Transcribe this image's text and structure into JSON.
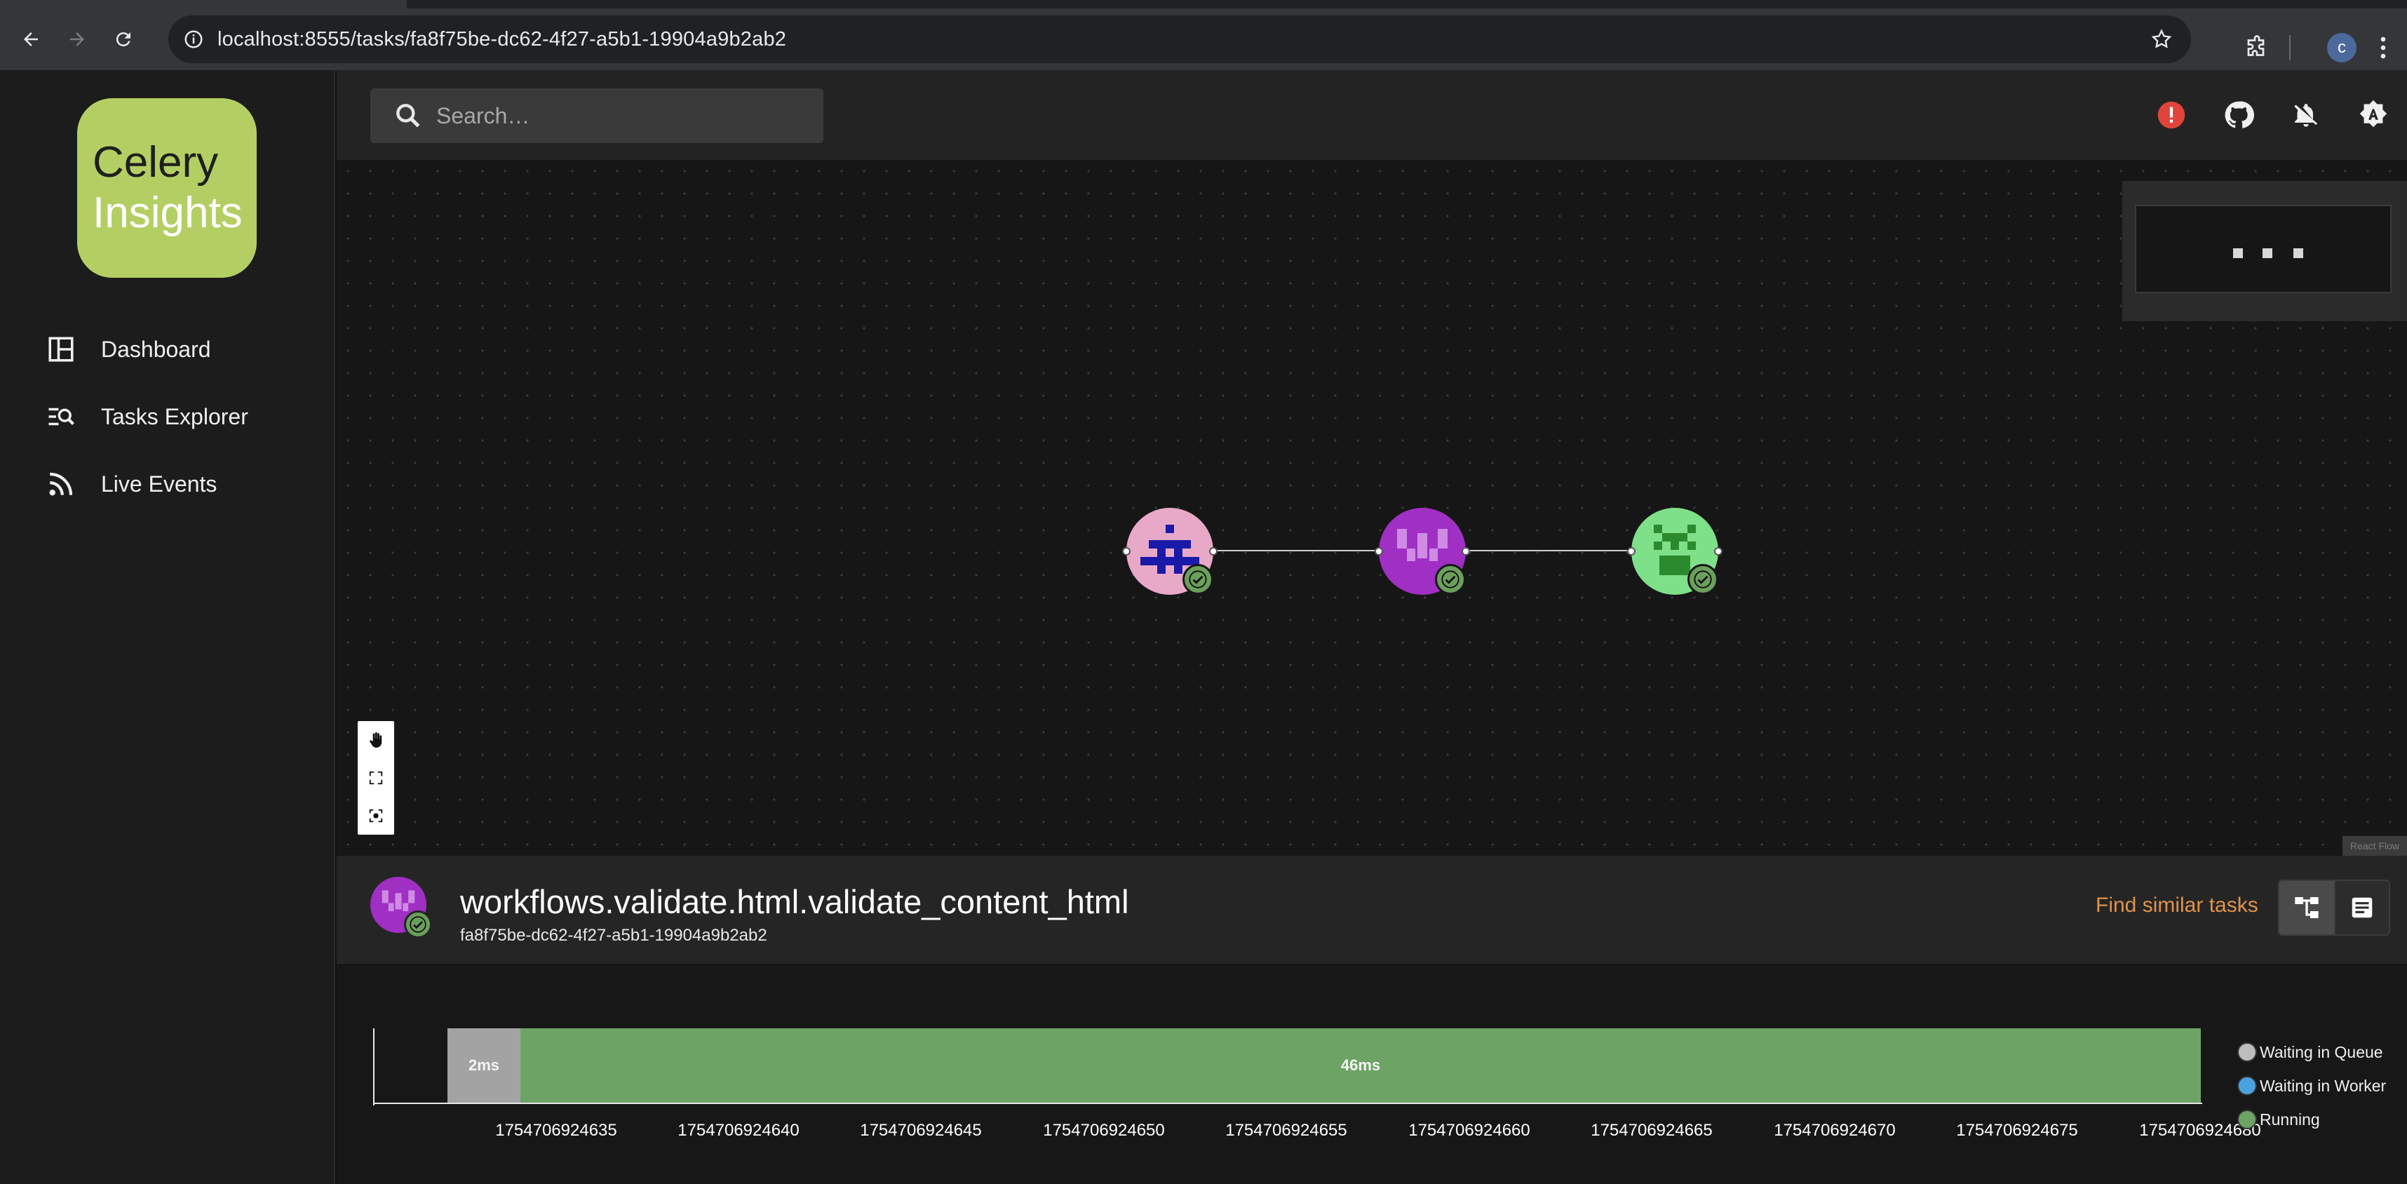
{
  "browser": {
    "url": "localhost:8555/tasks/fa8f75be-dc62-4f27-a5b1-19904a9b2ab2",
    "profile_initial": "c"
  },
  "sidebar": {
    "logo_line1": "Celery",
    "logo_line2": "Insights",
    "items": [
      {
        "label": "Dashboard",
        "icon": "dashboard-icon"
      },
      {
        "label": "Tasks Explorer",
        "icon": "tasks-explorer-icon"
      },
      {
        "label": "Live Events",
        "icon": "rss-icon"
      }
    ]
  },
  "topbar": {
    "search_placeholder": "Search…",
    "icons": [
      "error-icon",
      "github-icon",
      "notifications-off-icon",
      "theme-icon"
    ]
  },
  "graph": {
    "nodes": [
      {
        "name": "task-node-1",
        "color": "#e8a9c8",
        "state": "success"
      },
      {
        "name": "task-node-2",
        "color": "#a02fc4",
        "state": "success"
      },
      {
        "name": "task-node-3",
        "color": "#7fe08a",
        "state": "success"
      }
    ]
  },
  "task": {
    "name": "workflows.validate.html.validate_content_html",
    "id": "fa8f75be-dc62-4f27-a5b1-19904a9b2ab2",
    "find_similar_label": "Find similar tasks"
  },
  "timeline": {
    "segments": [
      {
        "label": "2ms",
        "state": "Waiting in Queue",
        "color": "#a3a3a3"
      },
      {
        "label": "46ms",
        "state": "Running",
        "color": "#6da466"
      }
    ],
    "ticks": [
      "1754706924635",
      "1754706924640",
      "1754706924645",
      "1754706924650",
      "1754706924655",
      "1754706924660",
      "1754706924665",
      "1754706924670",
      "1754706924675",
      "1754706924680"
    ],
    "legend": [
      {
        "label": "Waiting in Queue",
        "color": "#bdbdbd"
      },
      {
        "label": "Waiting in Worker",
        "color": "#4aa3e0"
      },
      {
        "label": "Running",
        "color": "#6da466"
      }
    ]
  }
}
